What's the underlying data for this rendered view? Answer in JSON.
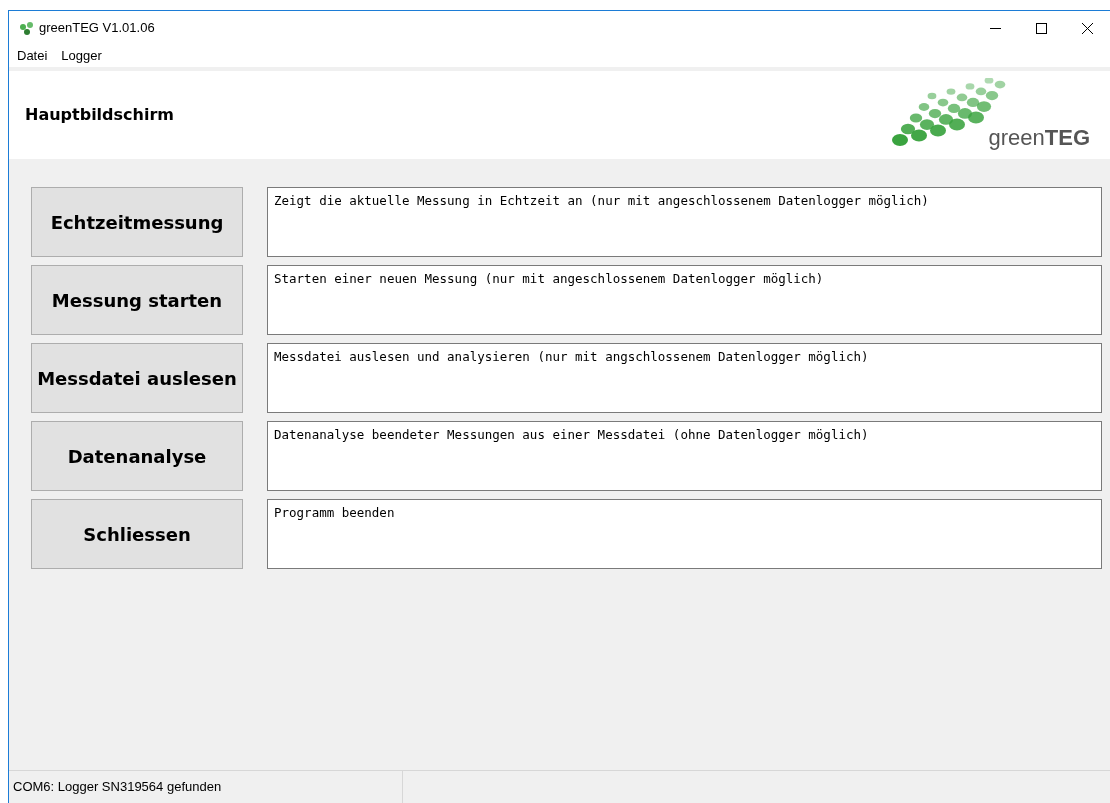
{
  "window": {
    "title": "greenTEG V1.01.06"
  },
  "menu": [
    "Datei",
    "Logger"
  ],
  "header": {
    "title": "Hauptbildschirm",
    "logo_text": "green**TEG**"
  },
  "actions": [
    {
      "button": "Echtzeitmessung",
      "description": "Zeigt die aktuelle Messung in Echtzeit an (nur mit angeschlossenem Datenlogger möglich)"
    },
    {
      "button": "Messung starten",
      "description": "Starten einer neuen Messung (nur mit angeschlossenem Datenlogger möglich)"
    },
    {
      "button": "Messdatei auslesen",
      "description": "Messdatei auslesen und analysieren (nur mit angschlossenem Datenlogger möglich)"
    },
    {
      "button": "Datenanalyse",
      "description": "Datenanalyse beendeter Messungen aus einer Messdatei (ohne Datenlogger möglich)"
    },
    {
      "button": "Schliessen",
      "description": "Programm beenden"
    }
  ],
  "status_bar": "COM6: Logger SN319564 gefunden"
}
